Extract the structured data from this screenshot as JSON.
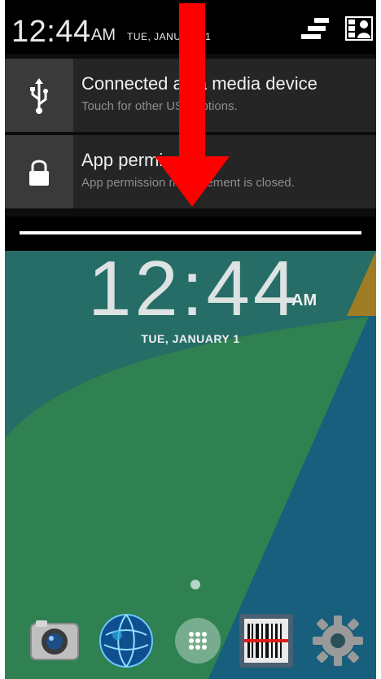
{
  "status_bar": {
    "time": "12:44",
    "ampm": "AM",
    "date": "TUE, JANUARY 1"
  },
  "quick_settings": {
    "settings_icon": "sliders-icon",
    "user_icon": "user-grid-icon"
  },
  "notifications": [
    {
      "icon": "usb-icon",
      "title": "Connected as a media device",
      "subtitle": "Touch for other USB options."
    },
    {
      "icon": "lock-icon",
      "title": "App permissions",
      "subtitle": "App permission management is closed."
    }
  ],
  "home": {
    "clock_time": "12:44",
    "clock_ampm": "AM",
    "clock_date": "TUE, JANUARY 1",
    "dock": [
      "camera-icon",
      "browser-globe-icon",
      "app-drawer-icon",
      "barcode-scanner-icon",
      "settings-gear-icon"
    ]
  },
  "colors": {
    "wallpaper_teal": "#2a7b78",
    "wallpaper_green": "#3a9a5b",
    "wallpaper_blue": "#1a5f8a",
    "wallpaper_orange": "#d6901c",
    "arrow_red": "#ff0000"
  }
}
